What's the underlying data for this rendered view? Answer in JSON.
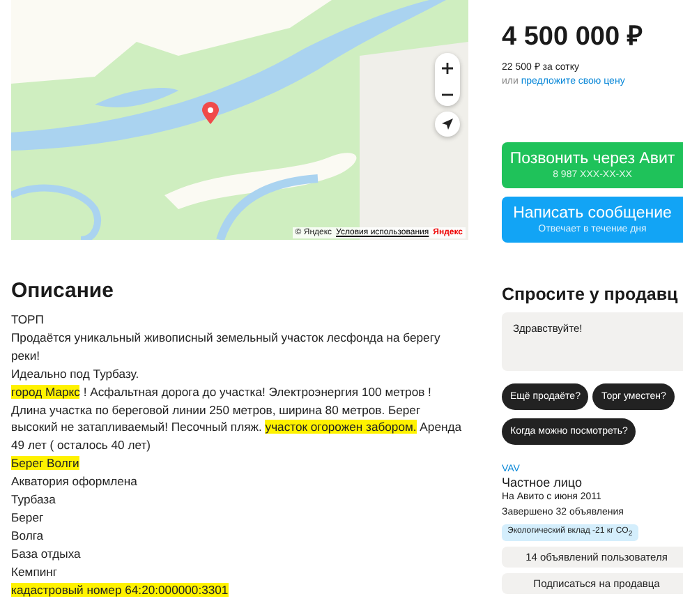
{
  "map": {
    "attribution": "© Яндекс",
    "terms_link": "Условия использования",
    "logo": "Яндекс"
  },
  "description": {
    "title": "Описание",
    "lines": [
      [
        {
          "text": "ТОРП",
          "highlighted": false
        }
      ],
      [
        {
          "text": "Продаётся уникальный живописный земельный участок лесфонда на берегу реки!",
          "highlighted": false
        }
      ],
      [
        {
          "text": "Идеально под Турбазу.",
          "highlighted": false
        }
      ],
      [
        {
          "text": "город Маркс",
          "highlighted": true
        },
        {
          "text": " ! Асфальтная дорога до участка! Электроэнергия 100 метров ! Длина участка по береговой линии 250 метров, ширина 80 метров. Берег высокий не затапливаемый! Песочный пляж. ",
          "highlighted": false
        },
        {
          "text": "участок огорожен забором.",
          "highlighted": true
        },
        {
          "text": " Аренда 49 лет ( осталось 40 лет)",
          "highlighted": false
        }
      ],
      [
        {
          "text": "Берег Волги",
          "highlighted": true
        }
      ],
      [
        {
          "text": "Акватория оформлена",
          "highlighted": false
        }
      ],
      [
        {
          "text": "Турбаза",
          "highlighted": false
        }
      ],
      [
        {
          "text": "Берег",
          "highlighted": false
        }
      ],
      [
        {
          "text": "Волга",
          "highlighted": false
        }
      ],
      [
        {
          "text": "База отдыха",
          "highlighted": false
        }
      ],
      [
        {
          "text": "Кемпинг",
          "highlighted": false
        }
      ],
      [
        {
          "text": "кадастровый номер 64:20:000000:3301",
          "highlighted": true
        }
      ]
    ]
  },
  "price": {
    "value": "4 500 000 ₽",
    "per_unit": "22 500 ₽ за сотку",
    "offer_prefix": "или",
    "offer_link": "предложите свою цену"
  },
  "contact_buttons": [
    {
      "kind": "call",
      "title": "Позвонить через Авит",
      "subtitle": "8 987 XXX-XX-XX"
    },
    {
      "kind": "message",
      "title": "Написать сообщение",
      "subtitle": "Отвечает в течение дня"
    }
  ],
  "ask_seller": {
    "title": "Спросите у продавц",
    "message": "Здравствуйте!",
    "chips": [
      "Ещё продаёте?",
      "Торг уместен?",
      "Когда можно посмотреть?"
    ]
  },
  "seller": {
    "name": "VAV",
    "type": "Частное лицо",
    "since": "На Авито с июня 2011",
    "completed": "Завершено 32 объявления",
    "eco_badge": "Экологический вклад -21 кг CO$_{2}$",
    "buttons": [
      "14 объявлений пользователя",
      "Подписаться на продавца"
    ]
  }
}
